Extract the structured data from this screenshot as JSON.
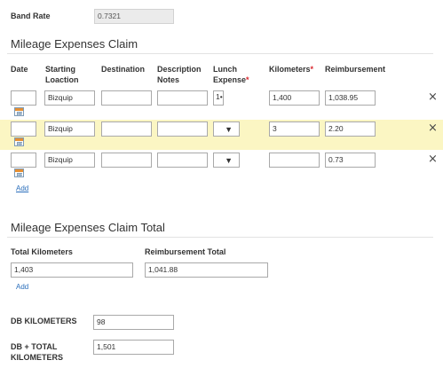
{
  "band_rate": {
    "label": "Band Rate",
    "value": "0.7321"
  },
  "claim": {
    "title": "Mileage Expenses Claim",
    "columns": {
      "date": "Date",
      "starting": "Starting Loaction",
      "destination": "Destination",
      "notes": "Description Notes",
      "lunch": "Lunch Expense",
      "km": "Kilometers",
      "reimb": "Reimbursement"
    },
    "rows": [
      {
        "date": "",
        "starting": "Bizquip",
        "destination": "",
        "notes": "",
        "lunch": "1•",
        "km": "1,400",
        "reimb": "1,038.95",
        "highlighted": false
      },
      {
        "date": "",
        "starting": "Bizquip",
        "destination": "",
        "notes": "",
        "lunch": "",
        "km": "3",
        "reimb": "2.20",
        "highlighted": true
      },
      {
        "date": "",
        "starting": "Bizquip",
        "destination": "",
        "notes": "",
        "lunch": "",
        "km": "",
        "reimb": "0.73",
        "highlighted": false
      }
    ],
    "add_label": "Add",
    "remove_glyph": "×",
    "dropdown_glyph": "▼",
    "required_mark": "*"
  },
  "total": {
    "title": "Mileage Expenses Claim Total",
    "total_km_label": "Total Kilometers",
    "total_km_value": "1,403",
    "reimb_total_label": "Reimbursement Total",
    "reimb_total_value": "1,041.88",
    "add_label": "Add"
  },
  "db": {
    "km_label": "DB KILOMETERS",
    "km_value": "98",
    "total_label_1": "DB + TOTAL",
    "total_label_2": "KILOMETERS",
    "total_value": "1,501"
  }
}
